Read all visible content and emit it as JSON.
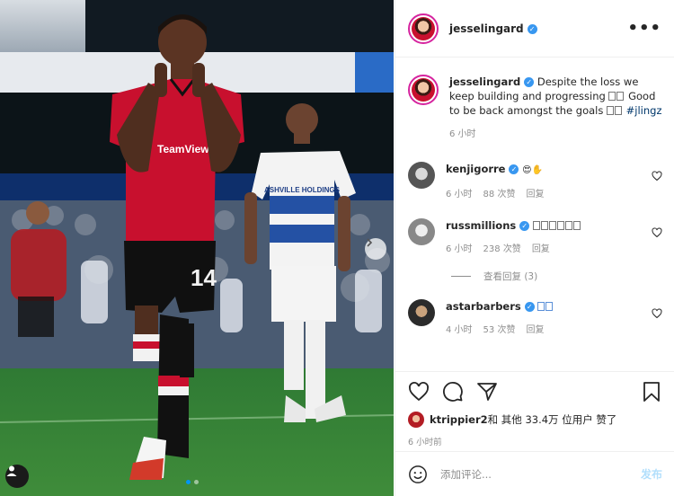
{
  "post": {
    "username": "jesselingard",
    "verified_mark": "✓",
    "more_label": "•••",
    "photo_jersey_number": "14",
    "photo_opponent_sponsor": "ASHVILLE HOLDINGS",
    "carousel_dot_count": 2,
    "carousel_active_index": 0
  },
  "caption": {
    "username": "jesselingard",
    "text": "Despite the loss we keep building and progressing",
    "text2": "Good to be back amongst the goals",
    "hashtag": "#jlingz",
    "time": "6 小时"
  },
  "comments": [
    {
      "username": "kenjigorre",
      "text_emojis": "😍✋",
      "time": "6 小时",
      "likes": "88 次赞",
      "reply": "回复"
    },
    {
      "username": "russmillions",
      "time": "6 小时",
      "likes": "238 次赞",
      "reply": "回复"
    },
    {
      "username": "astarbarbers",
      "time": "4 小时",
      "likes": "53 次赞",
      "reply": "回复"
    }
  ],
  "view_replies": "查看回复 (3)",
  "likes": {
    "user": "ktrippier2",
    "rest": " 和 其他 33.4万 位用户 赞了"
  },
  "posted_ago": "6 小时前",
  "add_comment": {
    "placeholder": "添加评论...",
    "post_button": "发布"
  },
  "colors": {
    "verified": "#3897f0",
    "link": "#00376b",
    "post_button_disabled": "#b2dffc",
    "united_red": "#c8102e"
  },
  "icons": [
    "heart-icon",
    "comment-icon",
    "share-icon",
    "bookmark-icon",
    "emoji-icon",
    "chevron-right-icon",
    "user-icon",
    "more-icon"
  ]
}
